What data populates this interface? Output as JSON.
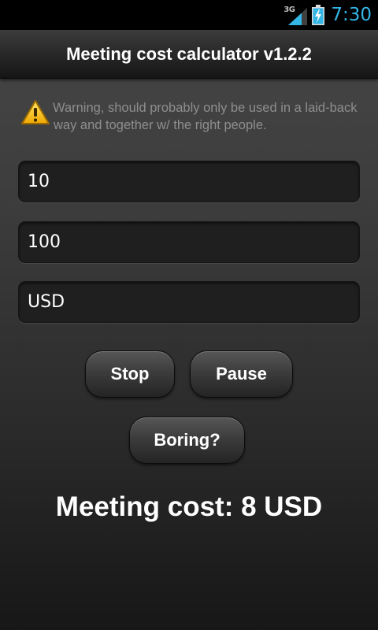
{
  "status_bar": {
    "network_type": "3G",
    "clock": "7:30",
    "icons": [
      "signal-3g-icon",
      "battery-charging-icon"
    ],
    "accent_color": "#33b5e5"
  },
  "title_bar": {
    "title": "Meeting cost calculator v1.2.2"
  },
  "warning": {
    "icon": "warning-triangle-icon",
    "text": "Warning, should probably only be used in a laid-back way and together w/ the right people."
  },
  "form": {
    "fields": [
      {
        "value": "10"
      },
      {
        "value": "100"
      },
      {
        "value": "USD"
      }
    ]
  },
  "buttons": {
    "stop": "Stop",
    "pause": "Pause",
    "boring": "Boring?"
  },
  "result": {
    "text": "Meeting cost: 8 USD"
  }
}
